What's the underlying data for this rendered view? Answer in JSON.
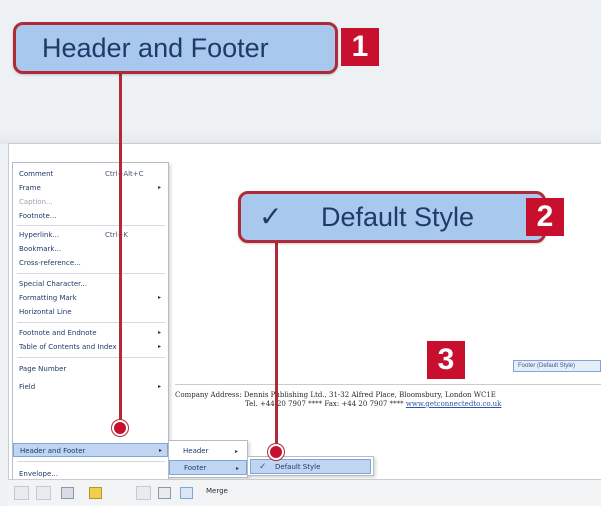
{
  "callouts": {
    "step1": {
      "label": "Header and Footer",
      "number": "1"
    },
    "step2": {
      "label": "Default Style",
      "number": "2"
    },
    "step3": {
      "number": "3"
    }
  },
  "menu": {
    "items": [
      {
        "label": "Comment",
        "shortcut": "Ctrl+Alt+C",
        "arrow": ""
      },
      {
        "label": "Frame",
        "shortcut": "",
        "arrow": "▸"
      },
      {
        "label": "Caption...",
        "shortcut": "",
        "arrow": "",
        "disabled": true
      },
      {
        "label": "Footnote...",
        "shortcut": "",
        "arrow": ""
      },
      {
        "label": "Hyperlink...",
        "shortcut": "Ctrl+K",
        "arrow": ""
      },
      {
        "label": "Bookmark...",
        "shortcut": "",
        "arrow": ""
      },
      {
        "label": "Cross-reference...",
        "shortcut": "",
        "arrow": ""
      },
      {
        "label": "Special Character...",
        "shortcut": "",
        "arrow": ""
      },
      {
        "label": "Formatting Mark",
        "shortcut": "",
        "arrow": "▸"
      },
      {
        "label": "Horizontal Line",
        "shortcut": "",
        "arrow": ""
      },
      {
        "label": "Footnote and Endnote",
        "shortcut": "",
        "arrow": "▸"
      },
      {
        "label": "Table of Contents and Index",
        "shortcut": "",
        "arrow": "▸"
      },
      {
        "label": "Page Number",
        "shortcut": "",
        "arrow": ""
      },
      {
        "label": "Field",
        "shortcut": "",
        "arrow": "▸"
      },
      {
        "label": "Header and Footer",
        "shortcut": "",
        "arrow": "▸",
        "highlighted": true
      },
      {
        "label": "Envelope...",
        "shortcut": "",
        "arrow": ""
      }
    ]
  },
  "submenu_header_footer": {
    "items": [
      {
        "label": "Header",
        "arrow": "▸"
      },
      {
        "label": "Footer",
        "arrow": "▸",
        "highlighted": true
      }
    ]
  },
  "submenu_footer": {
    "item": {
      "label": "Default Style",
      "check": "✓"
    }
  },
  "document": {
    "footer_line1": "Company Address: Dennis Publishing Ltd., 31-32 Alfred Place, Bloomsbury, London WC1E",
    "footer_line2_prefix": "Tel. +44 20 7907 **** Fax: +44 20 7907 ****",
    "footer_line2_link": "www.getconnectedto.co.uk",
    "footer_tag": "Footer (Default Style)"
  },
  "toolbar": {
    "merge_label": "Merge"
  },
  "colors": {
    "callout_fill": "#a9c8ee",
    "callout_border": "#b02a3a",
    "number_badge": "#c8102e",
    "menu_highlight": "#bfd5f2"
  }
}
